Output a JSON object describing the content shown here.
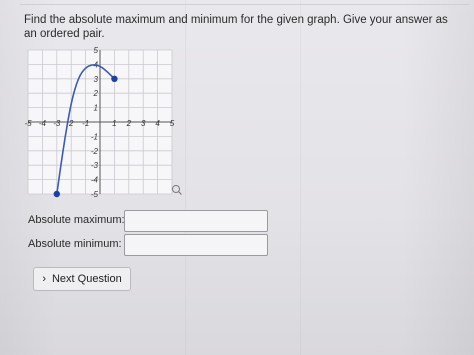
{
  "question": {
    "text_line1": "Find the absolute maximum and minimum for the given graph. Give your answer as",
    "text_line2": "an ordered pair."
  },
  "graph": {
    "x_ticks": [
      "-5",
      "-4",
      "-3",
      "2",
      "-1",
      "1",
      "2",
      "3",
      "4",
      "5"
    ],
    "y_ticks": [
      "5",
      "4",
      "3",
      "2",
      "1",
      "-1",
      "-2",
      "-3",
      "-4",
      "-5"
    ],
    "x_tick_values": [
      -5,
      -4,
      -3,
      -2,
      -1,
      1,
      2,
      3,
      4,
      5
    ],
    "y_tick_values": [
      5,
      4,
      3,
      2,
      1,
      -1,
      -2,
      -3,
      -4,
      -5
    ],
    "range": [
      -5,
      5
    ],
    "curve_points": [
      [
        -3,
        -5
      ],
      [
        -2.5,
        -1.5
      ],
      [
        -2,
        1.4
      ],
      [
        -1.5,
        3.1
      ],
      [
        -1,
        3.8
      ],
      [
        -0.5,
        4
      ],
      [
        0,
        3.9
      ],
      [
        0.5,
        3.5
      ],
      [
        1,
        3
      ]
    ],
    "endpoints": [
      [
        -3,
        -5
      ],
      [
        1,
        3
      ]
    ],
    "curve_color": "#3d5bb5",
    "point_color": "#1f3fa8",
    "zoom_icon": "magnifier-icon"
  },
  "answers": {
    "max_label": "Absolute maximum:",
    "min_label": "Absolute minimum:",
    "max_value": "",
    "min_value": ""
  },
  "next_button": {
    "label": "Next Question",
    "icon": "chevron-right-icon"
  }
}
